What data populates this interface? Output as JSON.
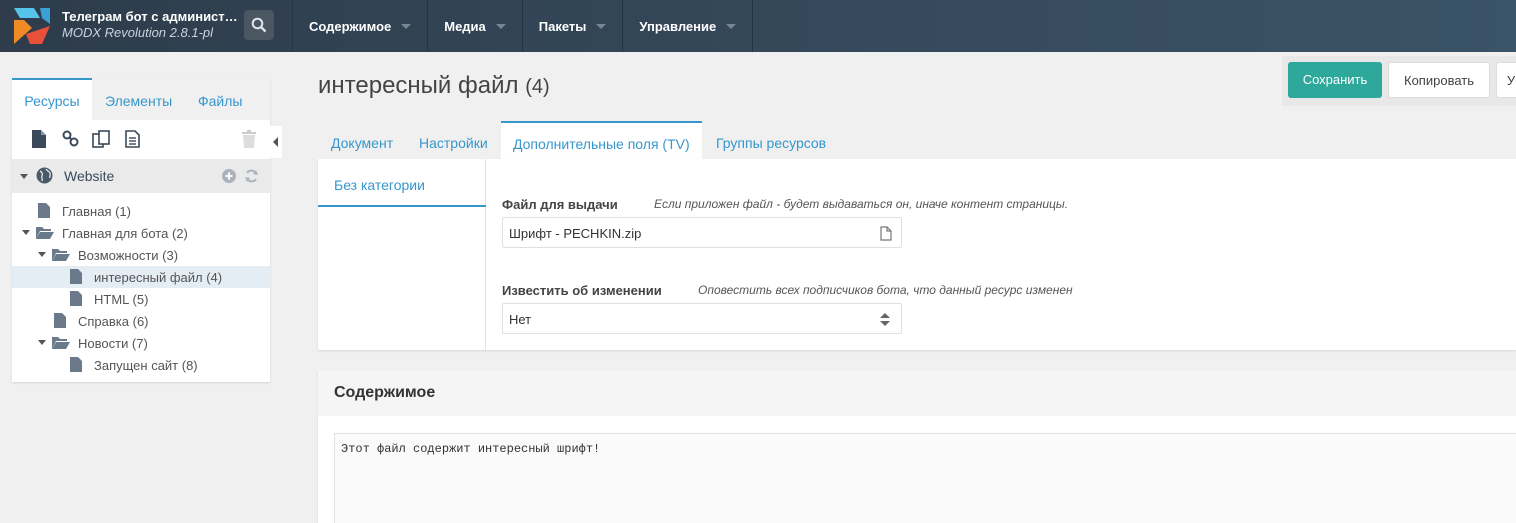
{
  "header": {
    "site_title": "Телеграм бот с администр…",
    "site_version": "MODX Revolution 2.8.1-pl",
    "nav": [
      {
        "label": "Содержимое"
      },
      {
        "label": "Медиа"
      },
      {
        "label": "Пакеты"
      },
      {
        "label": "Управление"
      }
    ]
  },
  "left_panel": {
    "tabs": [
      "Ресурсы",
      "Элементы",
      "Файлы"
    ],
    "active_tab": "Ресурсы",
    "toolbar_icons": [
      "new-document-icon",
      "weblink-icon",
      "symlink-icon",
      "static-resource-icon",
      "trash-icon"
    ],
    "context": "Website",
    "tree": [
      {
        "label": "Главная (1)"
      },
      {
        "label": "Главная для бота (2)"
      },
      {
        "label": "Возможности (3)"
      },
      {
        "label": "интересный файл (4)"
      },
      {
        "label": "HTML (5)"
      },
      {
        "label": "Справка (6)"
      },
      {
        "label": "Новости (7)"
      },
      {
        "label": "Запущен сайт (8)"
      }
    ]
  },
  "page": {
    "title": "интересный файл",
    "id_label": "(4)",
    "actions": {
      "save": "Сохранить",
      "copy": "Копировать",
      "more": "У"
    },
    "tabs": [
      "Документ",
      "Настройки",
      "Дополнительные поля (TV)",
      "Группы ресурсов"
    ],
    "active_tab": "Дополнительные поля (TV)",
    "tv_category": "Без категории",
    "fields": [
      {
        "label": "Файл для выдачи",
        "description": "Если приложен файл - будет выдаваться он, иначе контент страницы.",
        "value": "Шрифт - PECHKIN.zip"
      },
      {
        "label": "Известить об изменении",
        "description": "Оповестить всех подписчиков бота, что данный ресурс изменен",
        "value": "Нет"
      }
    ],
    "content": {
      "title": "Содержимое",
      "text": "Этот файл содержит интересный шрифт!"
    }
  },
  "colors": {
    "accent": "#3697cd",
    "save_button": "#2ea89a",
    "topbar": "#34485a"
  }
}
